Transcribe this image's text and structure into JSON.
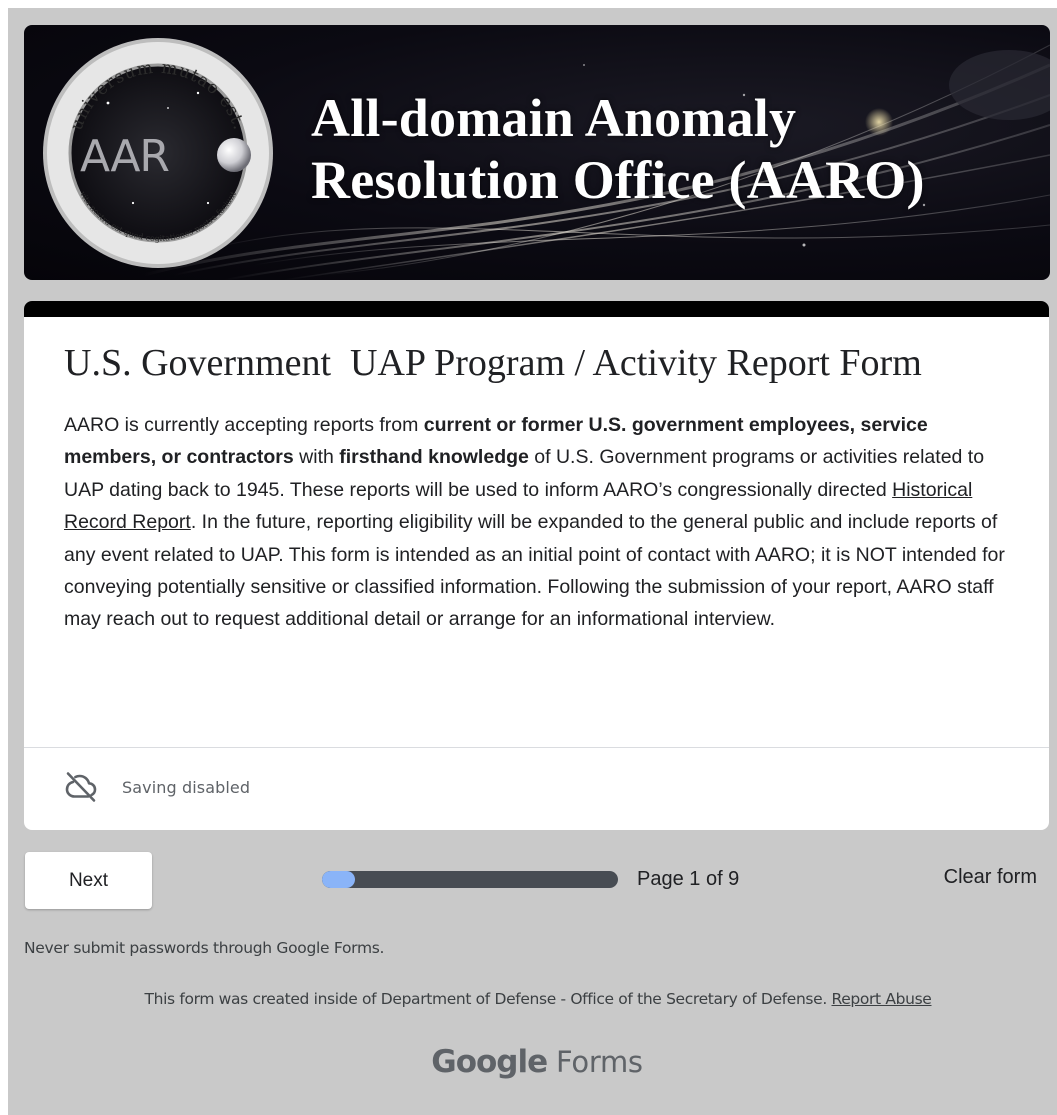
{
  "banner": {
    "title_line1": "All-domain Anomaly",
    "title_line2": "Resolution Office (AARO)",
    "seal": {
      "acronym": "AARO",
      "motto_top": "universum mutao est",
      "motto_bottom": "vita nostra est quod cogitationes nostra faciunt"
    }
  },
  "form": {
    "title": "U.S. Government  UAP Program / Activity Report Form",
    "description": {
      "p1": "AARO is currently accepting reports from ",
      "b1": "current or former U.S. government employees, service members, or contractors",
      "p2": " with ",
      "b2": "firsthand knowledge",
      "p3": " of U.S. Government programs or activities related to UAP dating back to 1945.   These reports will be used to  inform AARO’s congressionally directed ",
      "link": "Historical Record Report",
      "p4": ".  In the future, reporting eligibility will be expanded to the general public and include reports of any event related to UAP.  This form is intended as an initial point of contact with AARO; it is NOT intended for conveying potentially sensitive or classified information.   Following the submission of your report, AARO staff may reach out to request additional detail or arrange for an informational interview."
    },
    "saving_status": "Saving disabled",
    "saving_icon": "cloud-off-icon"
  },
  "navigation": {
    "next_label": "Next",
    "page_label": "Page 1 of 9",
    "progress_fraction": 0.111,
    "clear_label": "Clear form"
  },
  "footer": {
    "password_warning": "Never submit passwords through Google Forms.",
    "created_text": "This form was created inside of Department of Defense - Office of the Secretary of Defense. ",
    "report_abuse": "Report Abuse",
    "logo_google": "Google",
    "logo_forms": " Forms"
  },
  "colors": {
    "page_bg": "#c9c9c9",
    "card_topbar": "#000000",
    "progress_track": "#474c53",
    "progress_fill": "#8ab4f8",
    "text": "#202124",
    "muted": "#5f6368"
  }
}
